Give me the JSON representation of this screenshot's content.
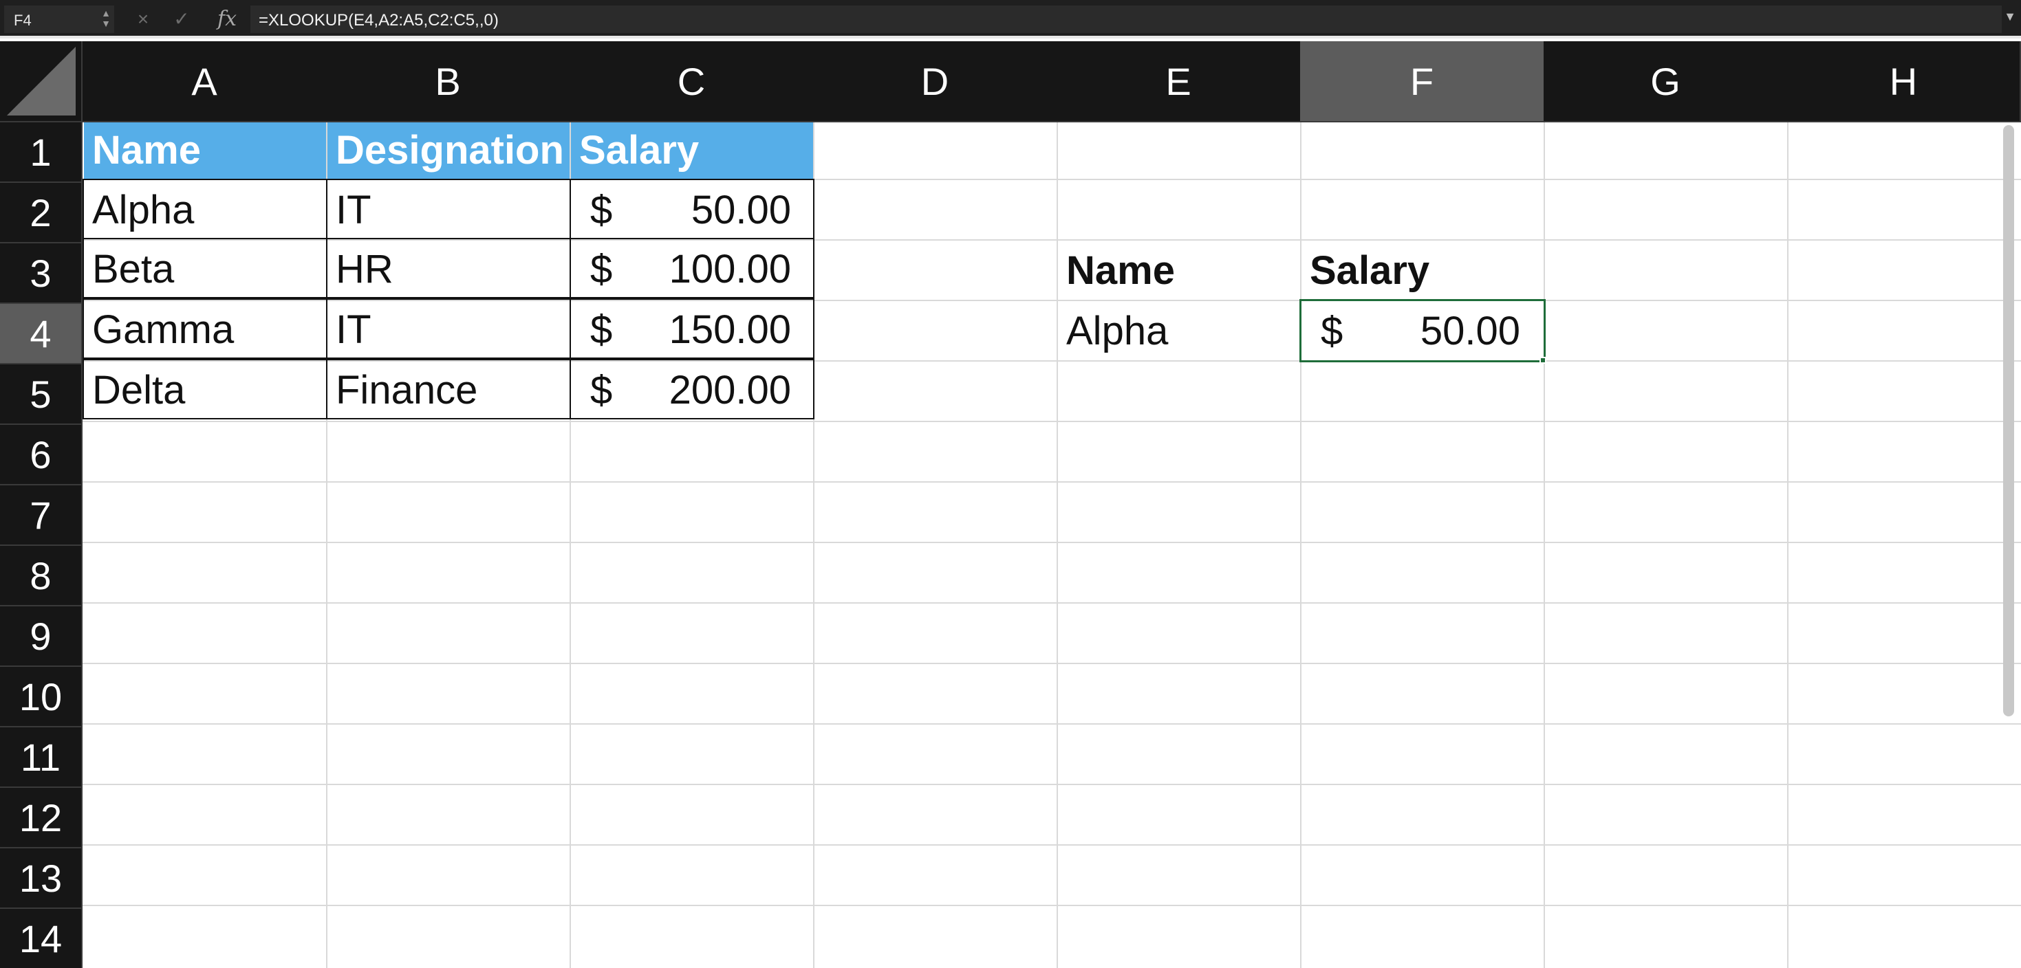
{
  "formula_bar": {
    "name_box": "F4",
    "cancel_icon": "×",
    "enter_icon": "✓",
    "fx_label": "fx",
    "formula": "=XLOOKUP(E4,A2:A5,C2:C5,,0)"
  },
  "columns": [
    "A",
    "B",
    "C",
    "D",
    "E",
    "F",
    "G",
    "H"
  ],
  "rows": [
    "1",
    "2",
    "3",
    "4",
    "5",
    "6",
    "7",
    "8",
    "9",
    "10",
    "11",
    "12",
    "13",
    "14"
  ],
  "selected": {
    "column": "F",
    "row": "4"
  },
  "table": {
    "headers": [
      "Name",
      "Designation",
      "Salary"
    ],
    "rows": [
      {
        "name": "Alpha",
        "designation": "IT",
        "currency": "$",
        "salary": "50.00"
      },
      {
        "name": "Beta",
        "designation": "HR",
        "currency": "$",
        "salary": "100.00"
      },
      {
        "name": "Gamma",
        "designation": "IT",
        "currency": "$",
        "salary": "150.00"
      },
      {
        "name": "Delta",
        "designation": "Finance",
        "currency": "$",
        "salary": "200.00"
      }
    ]
  },
  "lookup": {
    "name_header": "Name",
    "salary_header": "Salary",
    "name_value": "Alpha",
    "currency": "$",
    "salary_value": "50.00"
  },
  "colors": {
    "header_fill": "#56aee8",
    "selection": "#1f6d3a",
    "chrome": "#161616"
  }
}
